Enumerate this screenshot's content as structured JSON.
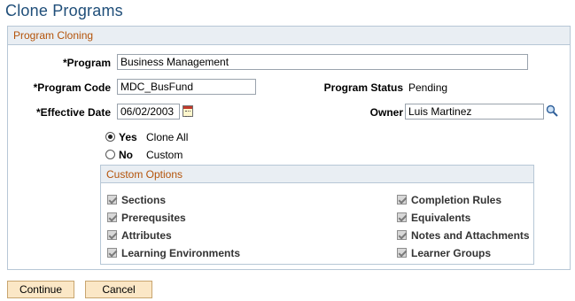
{
  "page": {
    "title": "Clone Programs"
  },
  "section": {
    "title": "Program Cloning",
    "program": {
      "label": "*Program",
      "value": "Business Management"
    },
    "program_code": {
      "label": "*Program Code",
      "value": "MDC_BusFund"
    },
    "program_status": {
      "label": "Program Status",
      "value": "Pending"
    },
    "effective_date": {
      "label": "*Effective Date",
      "value": "06/02/2003"
    },
    "owner": {
      "label": "Owner",
      "value": "Luis Martinez"
    },
    "clone_options": [
      {
        "label": "Yes",
        "description": "Clone All",
        "selected": true
      },
      {
        "label": "No",
        "description": "Custom",
        "selected": false
      }
    ]
  },
  "custom_options": {
    "title": "Custom Options",
    "left": [
      "Sections",
      "Prerequsites",
      "Attributes",
      "Learning Environments"
    ],
    "right": [
      "Completion Rules",
      "Equivalents",
      "Notes and Attachments",
      "Learner Groups"
    ]
  },
  "buttons": {
    "continue": "Continue",
    "cancel": "Cancel"
  },
  "icons": {
    "calendar": "calendar-icon",
    "search": "magnifier-icon"
  },
  "colors": {
    "title": "#1f4e79",
    "section_title": "#b45309",
    "button_bg": "#fbe7c6",
    "header_bg": "#e9eef3"
  }
}
